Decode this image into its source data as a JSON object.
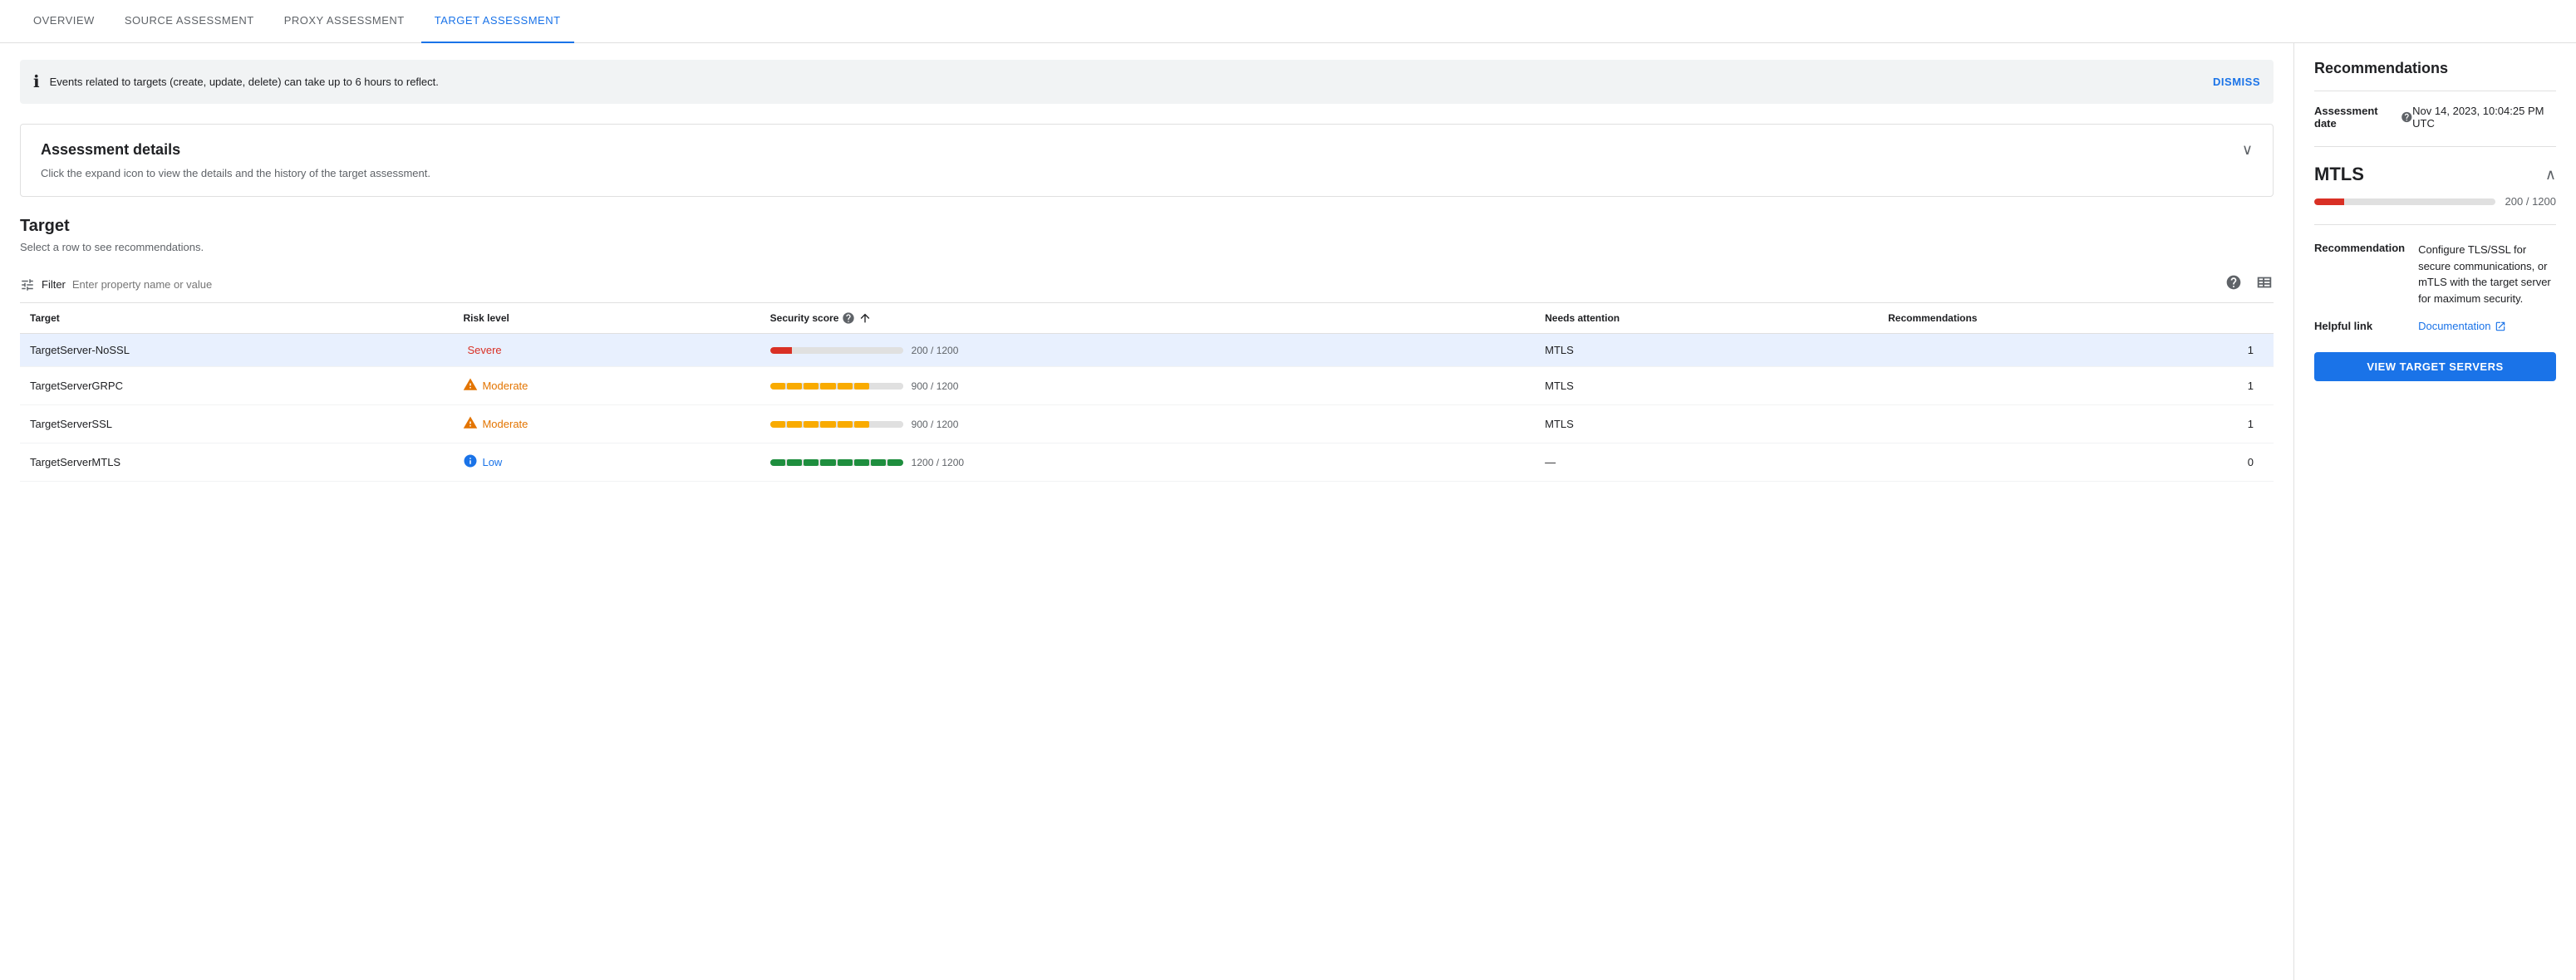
{
  "tabs": [
    {
      "id": "overview",
      "label": "OVERVIEW",
      "active": false
    },
    {
      "id": "source",
      "label": "SOURCE ASSESSMENT",
      "active": false
    },
    {
      "id": "proxy",
      "label": "PROXY ASSESSMENT",
      "active": false
    },
    {
      "id": "target",
      "label": "TARGET ASSESSMENT",
      "active": true
    }
  ],
  "banner": {
    "text": "Events related to targets (create, update, delete) can take up to 6 hours to reflect.",
    "dismiss_label": "DISMISS"
  },
  "assessment_details": {
    "title": "Assessment details",
    "description": "Click the expand icon to view the details and the history of the target assessment."
  },
  "target_section": {
    "title": "Target",
    "subtitle": "Select a row to see recommendations.",
    "filter": {
      "label": "Filter",
      "placeholder": "Enter property name or value"
    },
    "table": {
      "columns": [
        {
          "id": "target",
          "label": "Target"
        },
        {
          "id": "risk_level",
          "label": "Risk level"
        },
        {
          "id": "security_score",
          "label": "Security score"
        },
        {
          "id": "needs_attention",
          "label": "Needs attention"
        },
        {
          "id": "recommendations",
          "label": "Recommendations"
        }
      ],
      "rows": [
        {
          "target": "TargetServer-NoSSL",
          "risk_level": "Severe",
          "risk_class": "severe",
          "risk_icon": "error",
          "score_value": 200,
          "score_max": 1200,
          "score_label": "200 / 1200",
          "score_class": "severe",
          "score_pct": 16.67,
          "needs_attention": "MTLS",
          "recommendations": "1",
          "selected": true
        },
        {
          "target": "TargetServerGRPC",
          "risk_level": "Moderate",
          "risk_class": "moderate",
          "risk_icon": "warning",
          "score_value": 900,
          "score_max": 1200,
          "score_label": "900 / 1200",
          "score_class": "moderate",
          "score_pct": 75,
          "needs_attention": "MTLS",
          "recommendations": "1",
          "selected": false
        },
        {
          "target": "TargetServerSSL",
          "risk_level": "Moderate",
          "risk_class": "moderate",
          "risk_icon": "warning",
          "score_value": 900,
          "score_max": 1200,
          "score_label": "900 / 1200",
          "score_class": "moderate",
          "score_pct": 75,
          "needs_attention": "MTLS",
          "recommendations": "1",
          "selected": false
        },
        {
          "target": "TargetServerMTLS",
          "risk_level": "Low",
          "risk_class": "low",
          "risk_icon": "info",
          "score_value": 1200,
          "score_max": 1200,
          "score_label": "1200 / 1200",
          "score_class": "low",
          "score_pct": 100,
          "needs_attention": "—",
          "recommendations": "0",
          "selected": false
        }
      ]
    }
  },
  "sidebar": {
    "title": "Recommendations",
    "assessment_date_label": "Assessment date",
    "assessment_date_value": "Nov 14, 2023, 10:04:25 PM UTC",
    "mtls": {
      "title": "MTLS",
      "score_label": "200 / 1200",
      "score_pct": 16.67,
      "recommendation_label": "Recommendation",
      "recommendation_value": "Configure TLS/SSL for secure communications, or mTLS with the target server for maximum security.",
      "helpful_link_label": "Helpful link",
      "helpful_link_text": "Documentation",
      "helpful_link_icon": "external-link"
    },
    "view_btn_label": "VIEW TARGET SERVERS"
  },
  "icons": {
    "info_circle": "ℹ",
    "error_circle": "⊘",
    "warning_triangle": "⚠",
    "chevron_down": "∨",
    "chevron_up": "∧",
    "filter": "≡",
    "help": "?",
    "columns": "▦",
    "sort_asc": "↑",
    "external_link": "↗"
  }
}
